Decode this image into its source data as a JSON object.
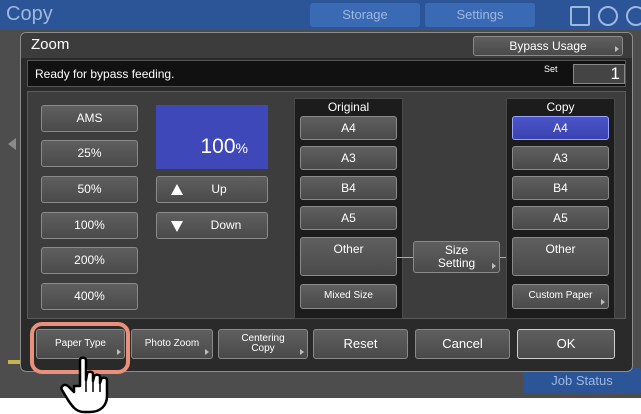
{
  "background": {
    "app_title": "Copy",
    "tabs": [
      "Storage",
      "Settings"
    ],
    "job_status": "Job Status"
  },
  "dialog": {
    "title": "Zoom",
    "bypass_usage": "Bypass Usage",
    "status_message": "Ready for bypass feeding.",
    "set_label": "Set",
    "set_value": "1"
  },
  "presets": [
    "AMS",
    "25%",
    "50%",
    "100%",
    "200%",
    "400%"
  ],
  "zoom": {
    "value": "100",
    "unit": "%",
    "up_label": "Up",
    "down_label": "Down"
  },
  "original": {
    "header": "Original",
    "sizes": [
      "A4",
      "A3",
      "B4",
      "A5",
      "Other"
    ],
    "mixed_size": "Mixed Size"
  },
  "size_setting": {
    "line1": "Size",
    "line2": "Setting"
  },
  "copy": {
    "header": "Copy",
    "sizes": [
      "A4",
      "A3",
      "B4",
      "A5",
      "Other"
    ],
    "selected": "A4",
    "custom_paper": "Custom Paper"
  },
  "footer": {
    "paper_type": "Paper Type",
    "photo_zoom": "Photo Zoom",
    "centering_line1": "Centering",
    "centering_line2": "Copy",
    "reset": "Reset",
    "cancel": "Cancel",
    "ok": "OK"
  },
  "colors": {
    "selected_blue": "#3e48b8",
    "highlight": "#e8907a"
  },
  "icons": [
    "up-arrow-icon",
    "down-arrow-icon",
    "home-icon",
    "globe-icon",
    "help-icon",
    "pointing-hand-icon"
  ]
}
